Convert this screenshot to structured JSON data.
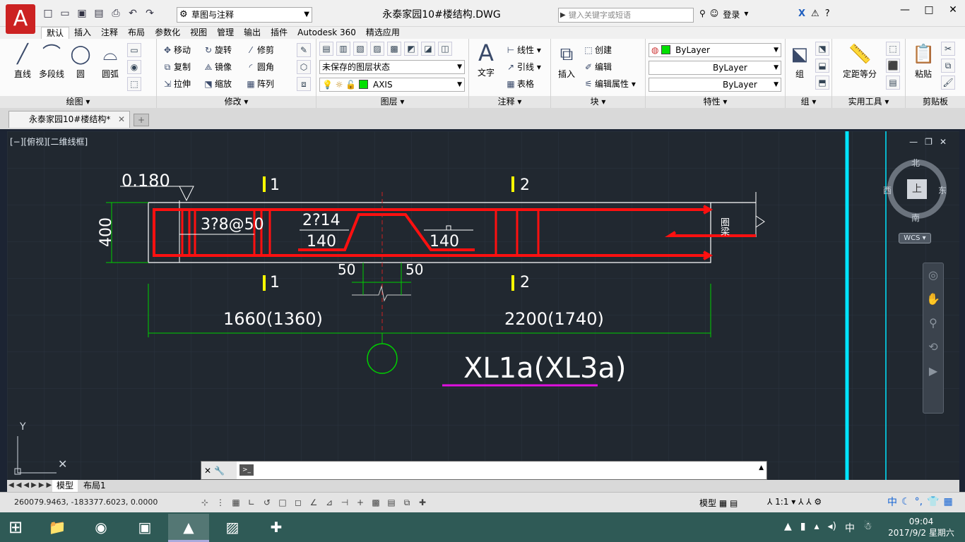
{
  "titlebar": {
    "logo": "A",
    "workspace": "草图与注释",
    "document_title": "永泰家园10#楼结构.DWG",
    "search_placeholder": "键入关键字或短语",
    "login": "登录",
    "qat_icons": [
      "new-icon",
      "open-icon",
      "save-icon",
      "saveas-icon",
      "print-icon",
      "undo-icon",
      "redo-icon"
    ]
  },
  "ribbon_tabs": [
    "默认",
    "插入",
    "注释",
    "布局",
    "参数化",
    "视图",
    "管理",
    "输出",
    "插件",
    "Autodesk 360",
    "精选应用"
  ],
  "panels": {
    "draw": {
      "title": "绘图",
      "tools": [
        "直线",
        "多段线",
        "圆",
        "圆弧"
      ]
    },
    "modify": {
      "title": "修改",
      "tools": [
        "移动",
        "旋转",
        "修剪",
        "复制",
        "镜像",
        "圆角",
        "拉伸",
        "缩放",
        "阵列"
      ]
    },
    "layers": {
      "title": "图层",
      "state": "未保存的图层状态",
      "layer": "AXIS"
    },
    "annotation": {
      "title": "注释",
      "text": "文字",
      "tools": [
        "线性",
        "引线",
        "表格"
      ]
    },
    "block": {
      "title": "块",
      "insert": "插入",
      "tools": [
        "创建",
        "编辑",
        "编辑属性"
      ]
    },
    "properties": {
      "title": "特性",
      "color": "ByLayer",
      "linetype": "ByLayer",
      "lineweight": "ByLayer"
    },
    "groups": {
      "title": "组",
      "label": "组"
    },
    "utilities": {
      "title": "实用工具",
      "label": "定距等分"
    },
    "clipboard": {
      "title": "剪贴板",
      "label": "粘贴"
    }
  },
  "file_tab": "永泰家园10#楼结构*",
  "viewport_label": "[−][俯视][二维线框]",
  "viewcube": {
    "face": "上",
    "north": "北",
    "south": "南",
    "east": "东",
    "west": "西",
    "wcs": "WCS"
  },
  "drawing": {
    "dim_top": "0.180",
    "dim_height": "400",
    "rebar_stirrup": "3?8@50",
    "rebar_bent": "2?14",
    "bend_left": "140",
    "bend_right": "140",
    "section_1": "1",
    "section_2": "2",
    "offset_left": "50",
    "offset_right": "50",
    "span_left": "1660(1360)",
    "span_right": "2200(1740)",
    "wall_label": "圈梁",
    "beam_id": "XL1a(XL3a)"
  },
  "layout_tabs": [
    "模型",
    "布局1"
  ],
  "status": {
    "coords": "260079.9463,  -183377.6023,  0.0000",
    "model": "模型",
    "scale": "1:1"
  },
  "taskbar": {
    "apps": [
      "explorer-icon",
      "browser-icon",
      "cad-viewer-icon",
      "autocad-icon",
      "photo-icon",
      "network-icon"
    ],
    "ime": "中",
    "time": "09:04",
    "date": "2017/9/2 星期六"
  },
  "colors": {
    "rebar": "#ff1010",
    "dimension": "#00d000",
    "section_marker": "#ffff00",
    "beam_outline": "#ffffff",
    "underline": "#e010e0",
    "grid_cyan": "#00e5ff"
  }
}
